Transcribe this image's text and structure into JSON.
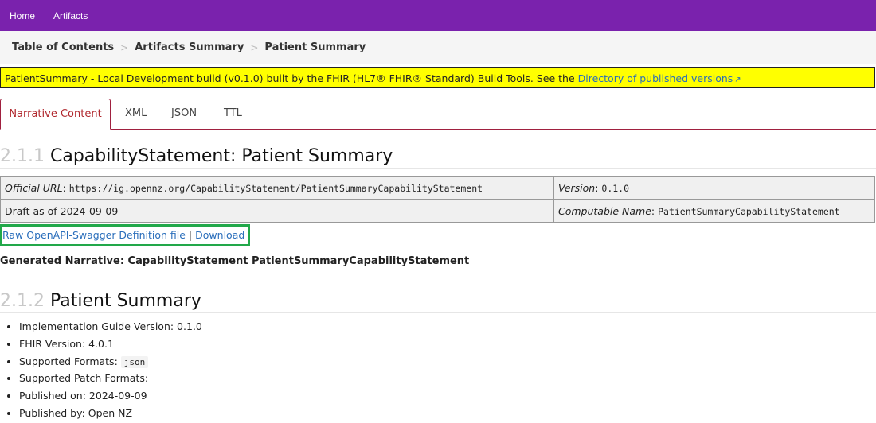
{
  "nav": {
    "home": "Home",
    "artifacts": "Artifacts"
  },
  "breadcrumb": {
    "items": [
      "Table of Contents",
      "Artifacts Summary",
      "Patient Summary"
    ],
    "sep": ">"
  },
  "banner": {
    "text": "PatientSummary - Local Development build (v0.1.0) built by the FHIR (HL7® FHIR® Standard) Build Tools. See the ",
    "link": "Directory of published versions"
  },
  "tabs": [
    "Narrative Content",
    "XML",
    "JSON",
    "TTL"
  ],
  "section1": {
    "num": "2.1.1",
    "title": "CapabilityStatement: Patient Summary"
  },
  "meta": {
    "official_url_label": "Official URL",
    "official_url": "https://ig.opennz.org/CapabilityStatement/PatientSummaryCapabilityStatement",
    "version_label": "Version",
    "version": "0.1.0",
    "draft": "Draft as of 2024-09-09",
    "computable_name_label": "Computable Name",
    "computable_name": "PatientSummaryCapabilityStatement"
  },
  "links": {
    "raw": "Raw OpenAPI-Swagger Definition file",
    "sep": "|",
    "download": "Download"
  },
  "generated": "Generated Narrative: CapabilityStatement PatientSummaryCapabilityStatement",
  "section2": {
    "num": "2.1.2",
    "title": "Patient Summary"
  },
  "facts": {
    "ig_version": "Implementation Guide Version: 0.1.0",
    "fhir_version": "FHIR Version: 4.0.1",
    "formats_label": "Supported Formats:",
    "formats_value": "json",
    "patch_formats": "Supported Patch Formats:",
    "published_on": "Published on: 2024-09-09",
    "published_by": "Published by: Open NZ"
  }
}
